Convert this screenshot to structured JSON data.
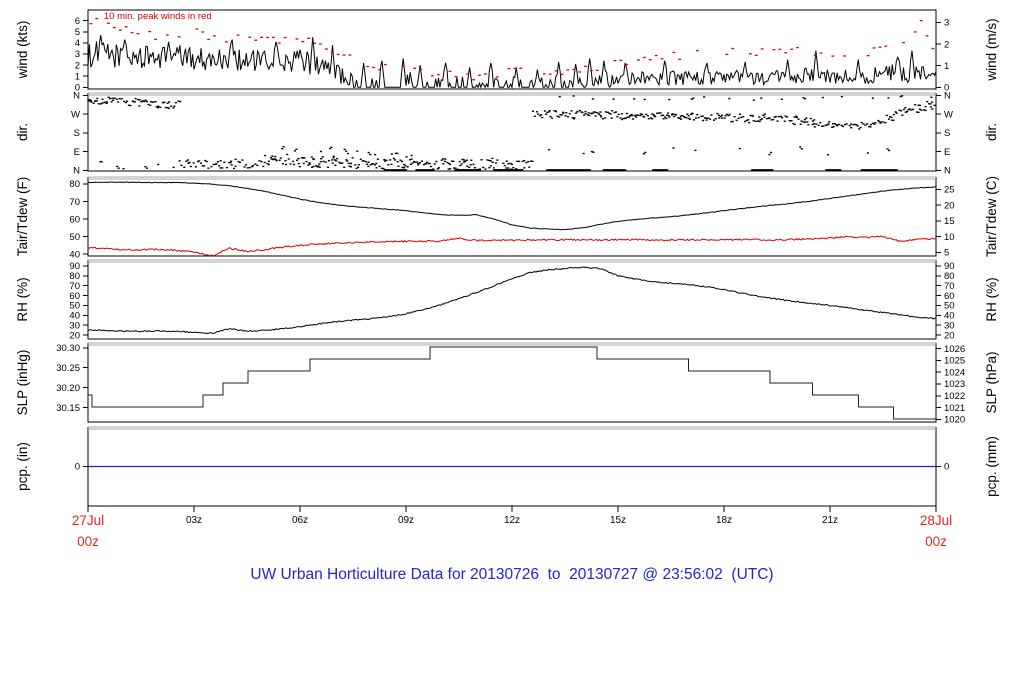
{
  "title": {
    "text": "UW Urban Horticulture Data for 20130726  to  20130727 @ 23:56:02  (UTC)"
  },
  "colors": {
    "trace_black": "#000000",
    "series_red": "#dd0000",
    "annotation_red": "#cc0000",
    "date_red": "#ee2222",
    "pcp_blue": "#2222cc",
    "title_blue": "#2222dd",
    "panel_gray": "#aaaaaa"
  },
  "chart_data": {
    "type": "multi-panel-timeseries",
    "noise_seed": 1234,
    "x_axis": {
      "hours": 24,
      "ticks": [
        {
          "t": 3,
          "label": "03z"
        },
        {
          "t": 6,
          "label": "06z"
        },
        {
          "t": 9,
          "label": "09z"
        },
        {
          "t": 12,
          "label": "12z"
        },
        {
          "t": 15,
          "label": "15z"
        },
        {
          "t": 18,
          "label": "18z"
        },
        {
          "t": 21,
          "label": "21z"
        }
      ],
      "start_label": [
        "27Jul",
        "00z"
      ],
      "end_label": [
        "28Jul",
        "00z"
      ]
    },
    "panels": [
      {
        "id": "wind",
        "left_label": "wind (kts)",
        "right_label": "wind (m/s)",
        "ylim": [
          -0.15,
          6.96
        ],
        "left_ticks": [
          {
            "v": 0,
            "label": "0"
          },
          {
            "v": 1,
            "label": "1"
          },
          {
            "v": 2,
            "label": "2"
          },
          {
            "v": 3,
            "label": "3"
          },
          {
            "v": 4,
            "label": "4"
          },
          {
            "v": 5,
            "label": "5"
          },
          {
            "v": 6,
            "label": "6"
          }
        ],
        "right_ticks": [
          {
            "v": 0,
            "label": "0"
          },
          {
            "v": 1.9438,
            "label": "1"
          },
          {
            "v": 3.8877,
            "label": "2"
          },
          {
            "v": 5.8315,
            "label": "3"
          }
        ],
        "annotation": "10 min. peak winds in red",
        "trace": {
          "dt_anchor": 0.5,
          "mean": [
            2.9,
            3.0,
            2.8,
            2.7,
            2.7,
            2.8,
            2.6,
            2.5,
            2.6,
            2.4,
            2.3,
            2.2,
            2.4,
            2.0,
            1.3,
            0.6,
            0.4,
            0.5,
            0.6,
            0.3,
            0.4,
            0.3,
            0.5,
            0.3,
            0.4,
            0.3,
            0.5,
            0.4,
            0.7,
            0.6,
            0.8,
            0.9,
            0.8,
            0.9,
            0.8,
            0.9,
            0.8,
            0.9,
            0.8,
            0.9,
            1.0,
            1.1,
            0.9,
            1.0,
            1.1,
            1.2,
            1.3,
            1.1,
            1.0
          ],
          "amp": [
            1.2,
            1.2,
            1.1,
            1.0,
            1.0,
            1.1,
            1.0,
            1.0,
            1.1,
            1.0,
            1.0,
            0.9,
            1.1,
            1.0,
            0.9,
            0.6,
            0.5,
            0.7,
            0.8,
            0.4,
            0.6,
            0.5,
            0.7,
            0.5,
            0.6,
            0.4,
            0.6,
            0.5,
            0.8,
            0.7,
            0.7,
            0.6,
            0.6,
            0.7,
            0.6,
            0.7,
            0.6,
            0.7,
            0.6,
            0.6,
            0.7,
            0.8,
            0.7,
            0.7,
            0.8,
            0.8,
            0.9,
            0.8,
            0.7
          ]
        },
        "spikes": [
          [
            0.35,
            4.7
          ],
          [
            1.05,
            4.3
          ],
          [
            2.3,
            4.1
          ],
          [
            4.1,
            4.3
          ],
          [
            5.3,
            4.1
          ],
          [
            6.35,
            4.5
          ],
          [
            6.9,
            3.8
          ],
          [
            7.8,
            2.2
          ],
          [
            8.3,
            2.4
          ],
          [
            8.9,
            2.6
          ],
          [
            9.4,
            2.0
          ],
          [
            10.1,
            2.2
          ],
          [
            10.8,
            1.8
          ],
          [
            11.4,
            2.2
          ],
          [
            12.1,
            1.8
          ],
          [
            12.7,
            1.6
          ],
          [
            13.3,
            2.3
          ],
          [
            13.8,
            2.1
          ],
          [
            14.2,
            2.6
          ],
          [
            14.6,
            2.4
          ],
          [
            15.2,
            2.2
          ],
          [
            16.3,
            2.4
          ],
          [
            17.5,
            2.2
          ],
          [
            18.6,
            2.3
          ],
          [
            19.8,
            2.5
          ],
          [
            20.6,
            3.3
          ],
          [
            21.8,
            2.5
          ],
          [
            22.9,
            2.7
          ],
          [
            23.3,
            3.3
          ]
        ],
        "peaks": {
          "t": [
            0,
            1,
            2,
            3,
            4,
            5,
            6,
            7,
            8,
            9,
            10,
            11,
            12,
            13,
            14,
            15,
            16,
            17,
            18,
            19,
            20,
            21,
            22,
            23,
            23.6,
            24
          ],
          "v": [
            6.2,
            5.2,
            4.5,
            5.0,
            4.3,
            4.4,
            4.3,
            3.2,
            1.8,
            1.5,
            1.2,
            1.0,
            1.3,
            1.2,
            1.7,
            2.2,
            2.6,
            3.0,
            3.2,
            3.0,
            3.2,
            3.0,
            3.2,
            3.5,
            6.0,
            3.2
          ]
        }
      },
      {
        "id": "dir",
        "left_label": "dir.",
        "right_label": "dir.",
        "ylim": [
          -3,
          372
        ],
        "left_ticks": [
          {
            "v": 360,
            "label": "N"
          },
          {
            "v": 270,
            "label": "W"
          },
          {
            "v": 180,
            "label": "S"
          },
          {
            "v": 90,
            "label": "E"
          },
          {
            "v": 0,
            "label": "N"
          }
        ],
        "right_ticks": [
          {
            "v": 360,
            "label": "N"
          },
          {
            "v": 270,
            "label": "W"
          },
          {
            "v": 180,
            "label": "S"
          },
          {
            "v": 90,
            "label": "E"
          },
          {
            "v": 0,
            "label": "N"
          }
        ],
        "bands": [
          {
            "t0": 0.0,
            "t1": 2.6,
            "d0": 338,
            "d1": 315,
            "spread": 20,
            "step": 0.05
          },
          {
            "t0": 0.3,
            "t1": 2.5,
            "d0": 25,
            "d1": 20,
            "spread": 18,
            "step": 0.4
          },
          {
            "t0": 2.6,
            "t1": 7.0,
            "d0": 30,
            "d1": 38,
            "spread": 24,
            "step": 0.055
          },
          {
            "t0": 7.0,
            "t1": 12.6,
            "d0": 36,
            "d1": 22,
            "spread": 26,
            "step": 0.05
          },
          {
            "t0": 5.0,
            "t1": 9.2,
            "d0": 85,
            "d1": 70,
            "spread": 28,
            "step": 0.22
          },
          {
            "t0": 12.6,
            "t1": 17.0,
            "d0": 272,
            "d1": 262,
            "spread": 20,
            "step": 0.045
          },
          {
            "t0": 17.0,
            "t1": 20.5,
            "d0": 260,
            "d1": 238,
            "spread": 20,
            "step": 0.05
          },
          {
            "t0": 20.5,
            "t1": 22.3,
            "d0": 222,
            "d1": 212,
            "spread": 16,
            "step": 0.055
          },
          {
            "t0": 22.3,
            "t1": 24.0,
            "d0": 232,
            "d1": 330,
            "spread": 20,
            "step": 0.05
          },
          {
            "t0": 13.2,
            "t1": 24.0,
            "d0": 348,
            "d1": 345,
            "spread": 10,
            "step": 0.55
          },
          {
            "t0": 12.8,
            "t1": 23.5,
            "d0": 100,
            "d1": 95,
            "spread": 22,
            "step": 0.9
          }
        ],
        "calm_runs": [
          [
            8.4,
            9.0
          ],
          [
            9.3,
            9.8
          ],
          [
            10.4,
            11.1
          ],
          [
            11.5,
            12.3
          ],
          [
            13.0,
            14.2
          ],
          [
            14.6,
            15.2
          ],
          [
            16.0,
            16.4
          ],
          [
            18.8,
            19.4
          ],
          [
            20.9,
            21.3
          ],
          [
            21.9,
            22.9
          ]
        ]
      },
      {
        "id": "temp",
        "left_label": "Tair/Tdew (F)",
        "right_label": "Tair/Tdew (C)",
        "ylim": [
          39,
          84
        ],
        "dt_anchor": 0.5,
        "left_ticks": [
          {
            "v": 40,
            "label": "40"
          },
          {
            "v": 50,
            "label": "50"
          },
          {
            "v": 60,
            "label": "60"
          },
          {
            "v": 70,
            "label": "70"
          },
          {
            "v": 80,
            "label": "80"
          }
        ],
        "right_ticks": [
          {
            "v": 41,
            "label": "5"
          },
          {
            "v": 50,
            "label": "10"
          },
          {
            "v": 59,
            "label": "15"
          },
          {
            "v": 68,
            "label": "20"
          },
          {
            "v": 77,
            "label": "25"
          }
        ],
        "series": [
          {
            "name": "Tair",
            "color_key": "trace_black",
            "jitter": 0.18,
            "values": [
              81.0,
              81.0,
              81.0,
              80.9,
              80.9,
              80.8,
              80.5,
              80.0,
              79.0,
              77.6,
              75.8,
              73.6,
              71.4,
              69.6,
              68.2,
              67.2,
              66.4,
              65.6,
              64.8,
              63.6,
              62.6,
              62.2,
              62.5,
              60.0,
              56.8,
              55.0,
              54.3,
              54.1,
              55.0,
              57.0,
              58.8,
              59.8,
              60.6,
              61.4,
              62.4,
              63.6,
              64.8,
              66.0,
              67.2,
              68.2,
              69.2,
              70.4,
              71.8,
              73.2,
              74.6,
              76.0,
              77.0,
              77.8,
              78.3
            ]
          },
          {
            "name": "Tdew",
            "color_key": "series_red",
            "jitter": 0.45,
            "values": [
              43.8,
              43.2,
              42.4,
              42.6,
              42.8,
              42.2,
              41.2,
              39.0,
              43.4,
              41.6,
              42.6,
              44.0,
              45.0,
              45.8,
              46.3,
              46.7,
              47.0,
              47.2,
              47.4,
              47.3,
              47.6,
              49.0,
              47.8,
              47.9,
              48.0,
              48.1,
              48.2,
              48.3,
              48.2,
              48.1,
              48.2,
              48.3,
              48.2,
              48.1,
              48.2,
              48.3,
              48.2,
              48.4,
              48.3,
              48.2,
              48.5,
              48.8,
              49.2,
              50.0,
              49.5,
              50.2,
              47.2,
              48.6,
              48.8
            ]
          }
        ]
      },
      {
        "id": "rh",
        "left_label": "RH (%)",
        "right_label": "RH (%)",
        "ylim": [
          16,
          96
        ],
        "dt_anchor": 0.5,
        "left_ticks": [
          {
            "v": 20,
            "label": "20"
          },
          {
            "v": 30,
            "label": "30"
          },
          {
            "v": 40,
            "label": "40"
          },
          {
            "v": 50,
            "label": "50"
          },
          {
            "v": 60,
            "label": "60"
          },
          {
            "v": 70,
            "label": "70"
          },
          {
            "v": 80,
            "label": "80"
          },
          {
            "v": 90,
            "label": "90"
          }
        ],
        "right_ticks": [
          {
            "v": 20,
            "label": "20"
          },
          {
            "v": 30,
            "label": "30"
          },
          {
            "v": 40,
            "label": "40"
          },
          {
            "v": 50,
            "label": "50"
          },
          {
            "v": 60,
            "label": "60"
          },
          {
            "v": 70,
            "label": "70"
          },
          {
            "v": 80,
            "label": "80"
          },
          {
            "v": 90,
            "label": "90"
          }
        ],
        "series": [
          {
            "name": "RH",
            "color_key": "trace_black",
            "jitter": 0.6,
            "values": [
              25,
              24.5,
              24,
              23.8,
              24,
              23.5,
              23,
              21.8,
              26.5,
              23.8,
              24.8,
              26.5,
              28.5,
              31,
              33.5,
              35,
              36.5,
              38.5,
              41.5,
              46,
              51,
              57,
              63,
              70,
              77,
              83,
              86,
              87.5,
              88.5,
              87.5,
              80,
              76.5,
              74,
              72.5,
              71,
              69,
              66,
              62.5,
              59,
              56.5,
              54,
              52,
              50,
              47.5,
              45,
              43,
              40.5,
              38,
              36.5
            ]
          }
        ]
      },
      {
        "id": "slp",
        "left_label": "SLP (inHg)",
        "right_label": "SLP (hPa)",
        "ylim": [
          30.114,
          30.312
        ],
        "left_ticks": [
          {
            "v": 30.15,
            "label": "30.15"
          },
          {
            "v": 30.2,
            "label": "30.20"
          },
          {
            "v": 30.25,
            "label": "30.25"
          },
          {
            "v": 30.3,
            "label": "30.30"
          }
        ],
        "right_ticks": [
          {
            "v": 30.1206,
            "label": "1020"
          },
          {
            "v": 30.1501,
            "label": "1021"
          },
          {
            "v": 30.1797,
            "label": "1022"
          },
          {
            "v": 30.2092,
            "label": "1023"
          },
          {
            "v": 30.2387,
            "label": "1024"
          },
          {
            "v": 30.2683,
            "label": "1025"
          },
          {
            "v": 30.2978,
            "label": "1026"
          }
        ],
        "steps": [
          [
            0,
            30.182
          ],
          [
            0.12,
            30.182
          ],
          [
            0.12,
            30.152
          ],
          [
            3.25,
            30.152
          ],
          [
            3.25,
            30.182
          ],
          [
            3.82,
            30.182
          ],
          [
            3.82,
            30.212
          ],
          [
            4.53,
            30.212
          ],
          [
            4.53,
            30.242
          ],
          [
            6.28,
            30.242
          ],
          [
            6.28,
            30.272
          ],
          [
            9.68,
            30.272
          ],
          [
            9.68,
            30.302
          ],
          [
            14.4,
            30.302
          ],
          [
            14.4,
            30.272
          ],
          [
            17.0,
            30.272
          ],
          [
            17.0,
            30.242
          ],
          [
            19.3,
            30.242
          ],
          [
            19.3,
            30.212
          ],
          [
            20.5,
            30.212
          ],
          [
            20.5,
            30.182
          ],
          [
            21.8,
            30.182
          ],
          [
            21.8,
            30.152
          ],
          [
            22.8,
            30.152
          ],
          [
            22.8,
            30.122
          ],
          [
            24,
            30.122
          ]
        ]
      },
      {
        "id": "pcp",
        "left_label": "pcp. (in)",
        "right_label": "pcp. (mm)",
        "ylim": [
          -1,
          1
        ],
        "left_ticks": [
          {
            "v": 0,
            "label": "0"
          }
        ],
        "right_ticks": [
          {
            "v": 0,
            "label": "0"
          }
        ],
        "value": 0
      }
    ]
  }
}
